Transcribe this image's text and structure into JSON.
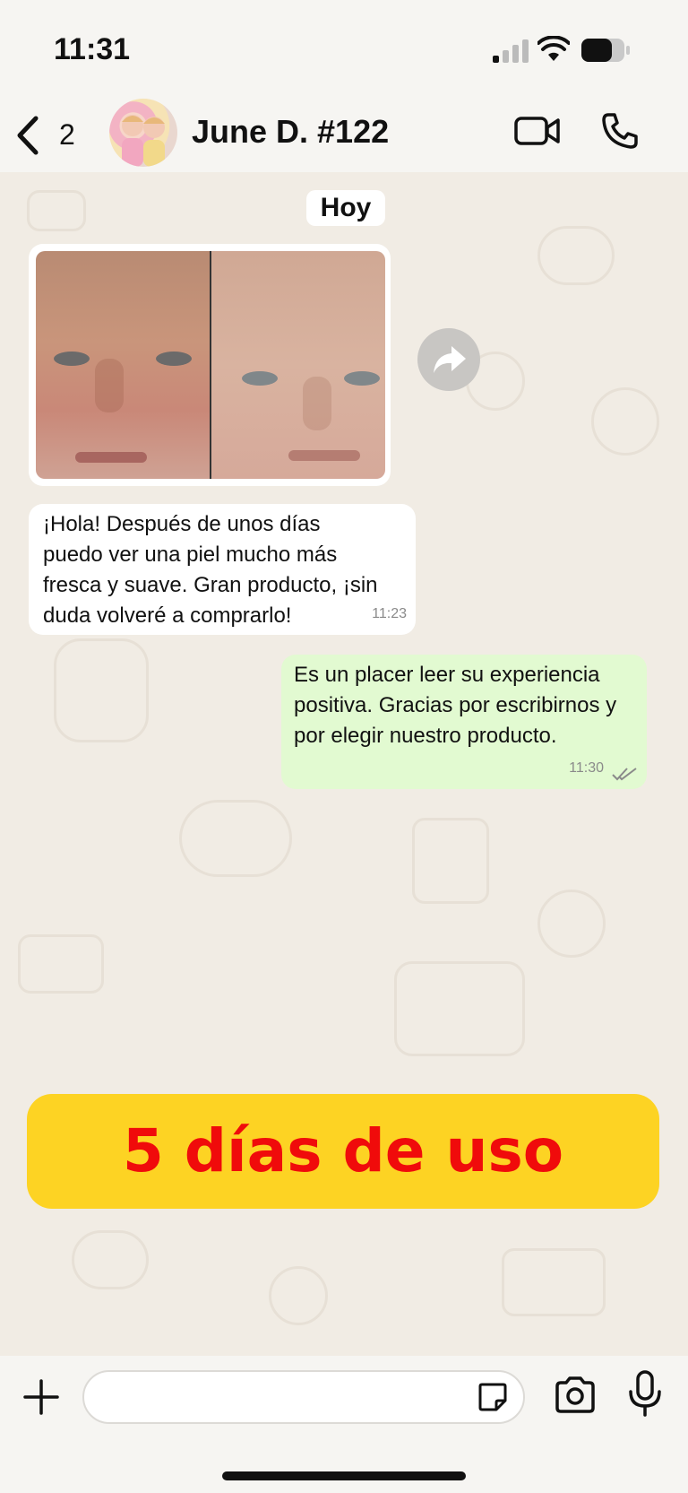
{
  "status_bar": {
    "time": "11:31"
  },
  "header": {
    "unread_count": "2",
    "contact_name": "June D. #122"
  },
  "chat": {
    "date_label": "Hoy",
    "incoming_message": {
      "text": "¡Hola! Después de unos días puedo ver una piel mucho más fresca y suave. Gran producto, ¡sin duda volveré a comprarlo!",
      "time": "11:23"
    },
    "outgoing_message": {
      "text": "Es un placer leer su experiencia positiva. Gracias por escribirnos y por elegir nuestro producto.",
      "time": "11:30"
    }
  },
  "promo_banner": {
    "text": "5 días de uso",
    "background_color": "#fdd323",
    "text_color": "#f00b0b"
  },
  "input_bar": {
    "placeholder": ""
  },
  "icons": {
    "back": "chevron-left-icon",
    "video": "video-camera-icon",
    "phone": "phone-icon",
    "forward": "forward-arrow-icon",
    "attach": "plus-icon",
    "sticker": "sticker-icon",
    "camera": "camera-icon",
    "mic": "microphone-icon"
  }
}
